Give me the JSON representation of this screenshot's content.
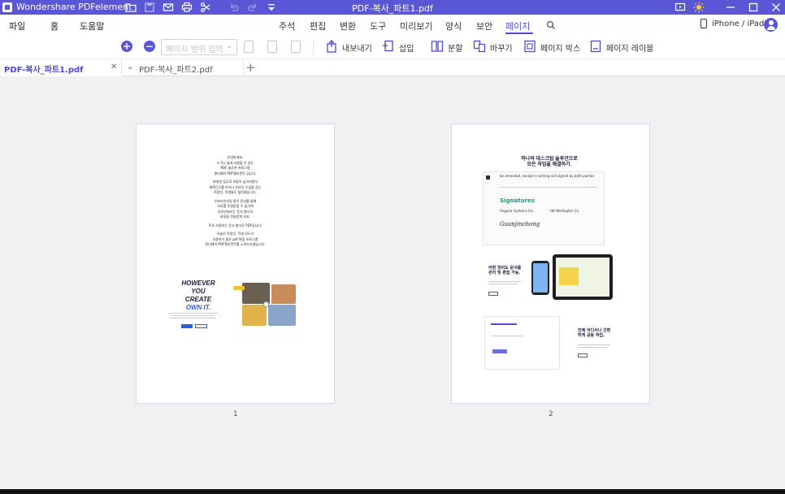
{
  "window": {
    "app_name": "Wondershare PDFelement",
    "document_title": "PDF-복사_파트1.pdf"
  },
  "menu": {
    "left_items": [
      "파일",
      "홈",
      "도움말"
    ],
    "tabs": [
      "주석",
      "편집",
      "변환",
      "도구",
      "미리보기",
      "양식",
      "보안",
      "페이지"
    ],
    "active_tab": "페이지",
    "device_link": "iPhone / iPad"
  },
  "toolbar": {
    "page_select_placeholder": "페이지 범위 입력",
    "tools": {
      "extract": "내보내기",
      "insert": "삽입",
      "split": "분할",
      "replace": "바꾸기",
      "page_box": "페이지 박스",
      "page_label": "페이지 레이블"
    }
  },
  "tabs": [
    {
      "label": "PDF-복사_파트1.pdf",
      "active": true
    },
    {
      "label": "PDF-복사_파트2.pdf",
      "active": false
    }
  ],
  "pages": [
    {
      "number": "1",
      "intro_lines": [
        "안녕하세요.",
        "누구나 쉽게 사용할 수 있는",
        "PDF 솔루션 프로그램",
        "원더쉐어 PDF엘리먼트 입니다.",
        "",
        "비대면 업무의 비중이 높아지면서",
        "재택근무를 하거나 온라인 수업을 듣는",
        "직장인, 학생들도 많아졌습니다.",
        "",
        "오프라인처럼 종이 문서를 통해",
        "자료를 전달받을 수 없기에",
        "온라인에서는 문서 형식의",
        "파일을 전달받게 되죠.",
        "",
        "주로 사용하는 문서 형식은 PDF입니다.",
        "",
        "오늘은 직장인, 학생 모두가",
        "사용하기 좋은 pdf 편집 프로그램",
        "원더쉐어 PDF엘리먼트를 소개드리겠습니다."
      ],
      "headline": [
        "HOWEVER YOU",
        "CREATE",
        "OWN IT."
      ]
    },
    {
      "number": "2",
      "title_lines": [
        "하나의 데스크탑 솔루션으로",
        "모든 작업을 해결하기."
      ],
      "clause_text": "be amended, except in writing and signed by both parties",
      "signatures_title": "Signatures",
      "party_a": "Angular Systems Inc.",
      "party_b": "HH Wellington Co.",
      "signature": "Guanjinchong",
      "feature_one": [
        "어떤 장비도 문서를",
        "관리 및 편집 가능."
      ],
      "feature_two": [
        "언제 어디서나 간편",
        "하게 공동 작업."
      ]
    }
  ],
  "colors": {
    "titlebar": "#5a57d6",
    "accent": "#4e4bd0",
    "canvas": "#f1f1f3"
  }
}
